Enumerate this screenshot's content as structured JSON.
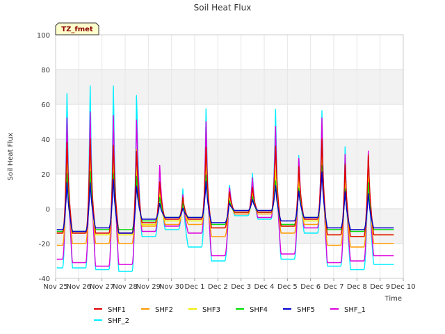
{
  "chart_data": {
    "type": "line",
    "title": "Soil Heat Flux",
    "xlabel": "Time",
    "ylabel": "Soil Heat Flux",
    "badge": "TZ_fmet",
    "ylim": [
      -40,
      100
    ],
    "yticks": [
      -40,
      -20,
      0,
      20,
      40,
      60,
      80,
      100
    ],
    "xlim": [
      0,
      15
    ],
    "xticks": [
      {
        "x": 0,
        "label": "Nov 25"
      },
      {
        "x": 1,
        "label": "Nov 26"
      },
      {
        "x": 2,
        "label": "Nov 27"
      },
      {
        "x": 3,
        "label": "Nov 28"
      },
      {
        "x": 4,
        "label": "Nov 29"
      },
      {
        "x": 5,
        "label": "Nov 30"
      },
      {
        "x": 6,
        "label": "Dec 1"
      },
      {
        "x": 7,
        "label": "Dec 2"
      },
      {
        "x": 8,
        "label": "Dec 3"
      },
      {
        "x": 9,
        "label": "Dec 4"
      },
      {
        "x": 10,
        "label": "Dec 5"
      },
      {
        "x": 11,
        "label": "Dec 6"
      },
      {
        "x": 12,
        "label": "Dec 7"
      },
      {
        "x": 13,
        "label": "Dec 8"
      },
      {
        "x": 14,
        "label": "Dec 9"
      },
      {
        "x": 15,
        "label": "Dec 10"
      }
    ],
    "data_end": 14.6,
    "daily_peaks": [
      {
        "day": 0,
        "SHF1": 44,
        "SHF2": 44,
        "SHF3": 30,
        "SHF4": 24,
        "SHF5": 18,
        "SHF_1": 61,
        "SHF_2": 77
      },
      {
        "day": 1,
        "SHF1": 46,
        "SHF2": 45,
        "SHF3": 32,
        "SHF4": 25,
        "SHF5": 18,
        "SHF_1": 65,
        "SHF_2": 82
      },
      {
        "day": 2,
        "SHF1": 42,
        "SHF2": 42,
        "SHF3": 30,
        "SHF4": 24,
        "SHF5": 20,
        "SHF_1": 63,
        "SHF_2": 82
      },
      {
        "day": 3,
        "SHF1": 38,
        "SHF2": 40,
        "SHF3": 28,
        "SHF4": 22,
        "SHF5": 16,
        "SHF_1": 60,
        "SHF_2": 76
      },
      {
        "day": 4,
        "SHF1": 18,
        "SHF2": 16,
        "SHF3": 10,
        "SHF4": 8,
        "SHF5": 4,
        "SHF_1": 29,
        "SHF_2": 27
      },
      {
        "day": 5,
        "SHF1": 8,
        "SHF2": 7,
        "SHF3": 5,
        "SHF4": 4,
        "SHF5": 1,
        "SHF_1": 10,
        "SHF_2": 14
      },
      {
        "day": 6,
        "SHF1": 40,
        "SHF2": 40,
        "SHF3": 28,
        "SHF4": 22,
        "SHF5": 18,
        "SHF_1": 57,
        "SHF_2": 66
      },
      {
        "day": 7,
        "SHF1": 12,
        "SHF2": 10,
        "SHF3": 8,
        "SHF4": 6,
        "SHF5": 4,
        "SHF_1": 16,
        "SHF_2": 18
      },
      {
        "day": 8,
        "SHF1": 14,
        "SHF2": 12,
        "SHF3": 10,
        "SHF4": 8,
        "SHF5": 6,
        "SHF_1": 20,
        "SHF_2": 23
      },
      {
        "day": 9,
        "SHF1": 40,
        "SHF2": 38,
        "SHF3": 25,
        "SHF4": 18,
        "SHF5": 15,
        "SHF_1": 53,
        "SHF_2": 64
      },
      {
        "day": 10,
        "SHF1": 28,
        "SHF2": 26,
        "SHF3": 18,
        "SHF4": 14,
        "SHF5": 12,
        "SHF_1": 35,
        "SHF_2": 37
      },
      {
        "day": 11,
        "SHF1": 45,
        "SHF2": 40,
        "SHF3": 32,
        "SHF4": 28,
        "SHF5": 24,
        "SHF_1": 59,
        "SHF_2": 64
      },
      {
        "day": 12,
        "SHF1": 30,
        "SHF2": 28,
        "SHF3": 18,
        "SHF4": 14,
        "SHF5": 12,
        "SHF_1": 38,
        "SHF_2": 43
      },
      {
        "day": 13,
        "SHF1": 36,
        "SHF2": 35,
        "SHF3": 22,
        "SHF4": 18,
        "SHF5": 11,
        "SHF_1": 40,
        "SHF_2": 38
      }
    ],
    "daily_troughs": [
      {
        "day": 0,
        "SHF1": -14,
        "SHF2": -21,
        "SHF3": -14,
        "SHF4": -13,
        "SHF5": -12,
        "SHF_1": -29,
        "SHF_2": -34
      },
      {
        "day": 1,
        "SHF1": -14,
        "SHF2": -20,
        "SHF3": -14,
        "SHF4": -13,
        "SHF5": -13,
        "SHF_1": -31,
        "SHF_2": -34
      },
      {
        "day": 2,
        "SHF1": -14,
        "SHF2": -20,
        "SHF3": -15,
        "SHF4": -12,
        "SHF5": -11,
        "SHF_1": -33,
        "SHF_2": -35
      },
      {
        "day": 3,
        "SHF1": -14,
        "SHF2": -20,
        "SHF3": -15,
        "SHF4": -12,
        "SHF5": -14,
        "SHF_1": -32,
        "SHF_2": -36
      },
      {
        "day": 4,
        "SHF1": -8,
        "SHF2": -10,
        "SHF3": -9,
        "SHF4": -7,
        "SHF5": -6,
        "SHF_1": -13,
        "SHF_2": -16
      },
      {
        "day": 5,
        "SHF1": -6,
        "SHF2": -9,
        "SHF3": -7,
        "SHF4": -5,
        "SHF5": -5,
        "SHF_1": -10,
        "SHF_2": -12
      },
      {
        "day": 6,
        "SHF1": -6,
        "SHF2": -9,
        "SHF3": -7,
        "SHF4": -5,
        "SHF5": -5,
        "SHF_1": -14,
        "SHF_2": -22
      },
      {
        "day": 7,
        "SHF1": -11,
        "SHF2": -16,
        "SHF3": -11,
        "SHF4": -9,
        "SHF5": -8,
        "SHF_1": -27,
        "SHF_2": -30
      },
      {
        "day": 8,
        "SHF1": -2,
        "SHF2": -3,
        "SHF3": -2,
        "SHF4": -2,
        "SHF5": -1,
        "SHF_1": -3,
        "SHF_2": -4
      },
      {
        "day": 9,
        "SHF1": -2,
        "SHF2": -3,
        "SHF3": -2,
        "SHF4": -2,
        "SHF5": -1,
        "SHF_1": -5,
        "SHF_2": -6
      },
      {
        "day": 10,
        "SHF1": -10,
        "SHF2": -14,
        "SHF3": -10,
        "SHF4": -9,
        "SHF5": -7,
        "SHF_1": -26,
        "SHF_2": -29
      },
      {
        "day": 11,
        "SHF1": -6,
        "SHF2": -9,
        "SHF3": -7,
        "SHF4": -5,
        "SHF5": -5,
        "SHF_1": -11,
        "SHF_2": -14
      },
      {
        "day": 12,
        "SHF1": -15,
        "SHF2": -21,
        "SHF3": -15,
        "SHF4": -12,
        "SHF5": -11,
        "SHF_1": -31,
        "SHF_2": -33
      },
      {
        "day": 13,
        "SHF1": -16,
        "SHF2": -22,
        "SHF3": -16,
        "SHF4": -13,
        "SHF5": -12,
        "SHF_1": -30,
        "SHF_2": -35
      },
      {
        "day": 14,
        "SHF1": -15,
        "SHF2": -20,
        "SHF3": -15,
        "SHF4": -12,
        "SHF5": -11,
        "SHF_1": -27,
        "SHF_2": -32
      }
    ],
    "series": [
      {
        "name": "SHF1",
        "color": "#dd0000"
      },
      {
        "name": "SHF2",
        "color": "#ff9900"
      },
      {
        "name": "SHF3",
        "color": "#eeee00"
      },
      {
        "name": "SHF4",
        "color": "#00dd00"
      },
      {
        "name": "SHF5",
        "color": "#0000cc"
      },
      {
        "name": "SHF_1",
        "color": "#dd00dd"
      },
      {
        "name": "SHF_2",
        "color": "#00eeff"
      }
    ],
    "grid": true,
    "legend_position": "bottom"
  }
}
